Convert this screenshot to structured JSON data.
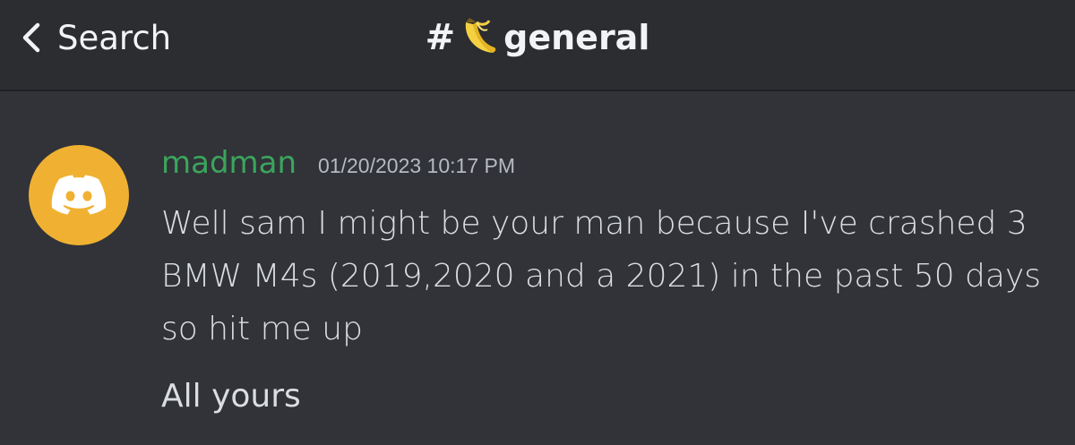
{
  "header": {
    "back_label": "Search",
    "channel_prefix": "#",
    "channel_emoji": "banana-icon",
    "channel_name": "general"
  },
  "message": {
    "username": "madman",
    "username_color": "#3ba55c",
    "timestamp": "01/20/2023 10:17 PM",
    "avatar_icon": "discord-logo-icon",
    "avatar_color": "#f0b132",
    "lines": [
      "Well sam I might be your man because I've crashed 3 BMW M4s (2019,2020 and a 2021) in the past 50 days so hit me up",
      "All yours"
    ]
  },
  "colors": {
    "background": "#313338",
    "header_background": "#2b2d31",
    "text": "#dbdee1"
  }
}
